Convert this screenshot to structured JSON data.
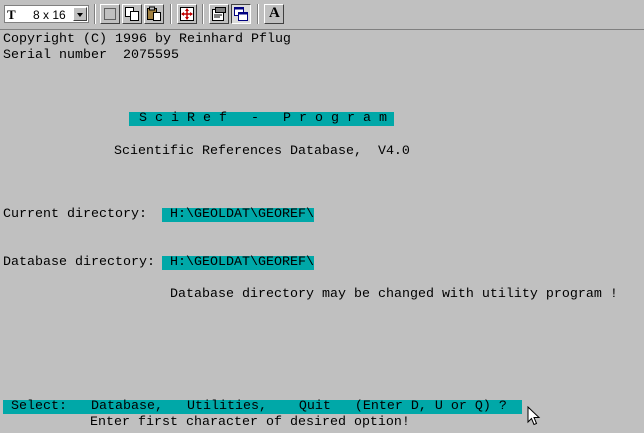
{
  "toolbar": {
    "font_size": "8 x 16",
    "buttons": [
      "select-icon",
      "copy-icon",
      "paste-icon",
      "fullscreen-icon",
      "properties-icon",
      "background-icon",
      "font-icon"
    ],
    "font_button_label": "A"
  },
  "console": {
    "copyright": "Copyright (C) 1996 by Reinhard Pflug",
    "serial": "Serial number  2075595",
    "program_title": "S c i R e f   -   P r o g r a m",
    "subtitle": "Scientific References Database,  V4.0",
    "current_dir_label": "Current directory:",
    "current_dir_value": " H:\\GEOLDAT\\GEOREF\\",
    "db_dir_label": "Database directory:",
    "db_dir_value": " H:\\GEOLDAT\\GEOREF\\",
    "db_note": "Database directory may be changed with utility program !",
    "select_line": " Select:   Database,   Utilities,    Quit   (Enter D, U or Q) ?",
    "hint_line": "Enter first character of desired option!"
  },
  "colors": {
    "background": "#c0c0c0",
    "highlight": "#00a8a8",
    "text": "#000000"
  }
}
